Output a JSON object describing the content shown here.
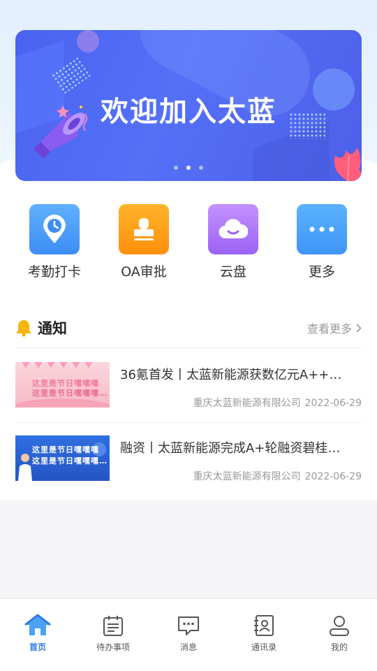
{
  "banner": {
    "title": "欢迎加入太蓝",
    "page_count": 3,
    "active_page": 2
  },
  "shortcuts": [
    {
      "label": "考勤打卡",
      "icon": "location-clock-icon",
      "color": "#4a9af8"
    },
    {
      "label": "OA审批",
      "icon": "stamp-icon",
      "color": "#ffa11a"
    },
    {
      "label": "云盘",
      "icon": "cloud-icon",
      "color": "#ad78f8"
    },
    {
      "label": "更多",
      "icon": "more-dots-icon",
      "color": "#4aa2f8"
    }
  ],
  "notice": {
    "title": "通知",
    "more_label": "查看更多",
    "items": [
      {
        "title": "36氪首发丨太蓝新能源获数亿元A++…",
        "source": "重庆太蓝新能源有限公司",
        "date": "2022-06-29",
        "thumb_text": [
          "这里是节日嘿嘿嘿",
          "这里是节日嘿嘿嘿…"
        ]
      },
      {
        "title": "融资丨太蓝新能源完成A+轮融资碧桂…",
        "source": "重庆太蓝新能源有限公司",
        "date": "2022-06-29",
        "thumb_text": [
          "这里是节日嘿嘿嘿",
          "这里是节日嘿嘿嘿…"
        ]
      }
    ]
  },
  "bottom_nav": [
    {
      "label": "首页",
      "icon": "home-icon",
      "active": true
    },
    {
      "label": "待办事项",
      "icon": "todo-icon",
      "active": false
    },
    {
      "label": "消息",
      "icon": "message-icon",
      "active": false
    },
    {
      "label": "通讯录",
      "icon": "contacts-icon",
      "active": false
    },
    {
      "label": "我的",
      "icon": "user-icon",
      "active": false
    }
  ],
  "colors": {
    "accent": "#2f7ae5",
    "banner": "#4f68f3",
    "bell": "#f5b50a"
  }
}
